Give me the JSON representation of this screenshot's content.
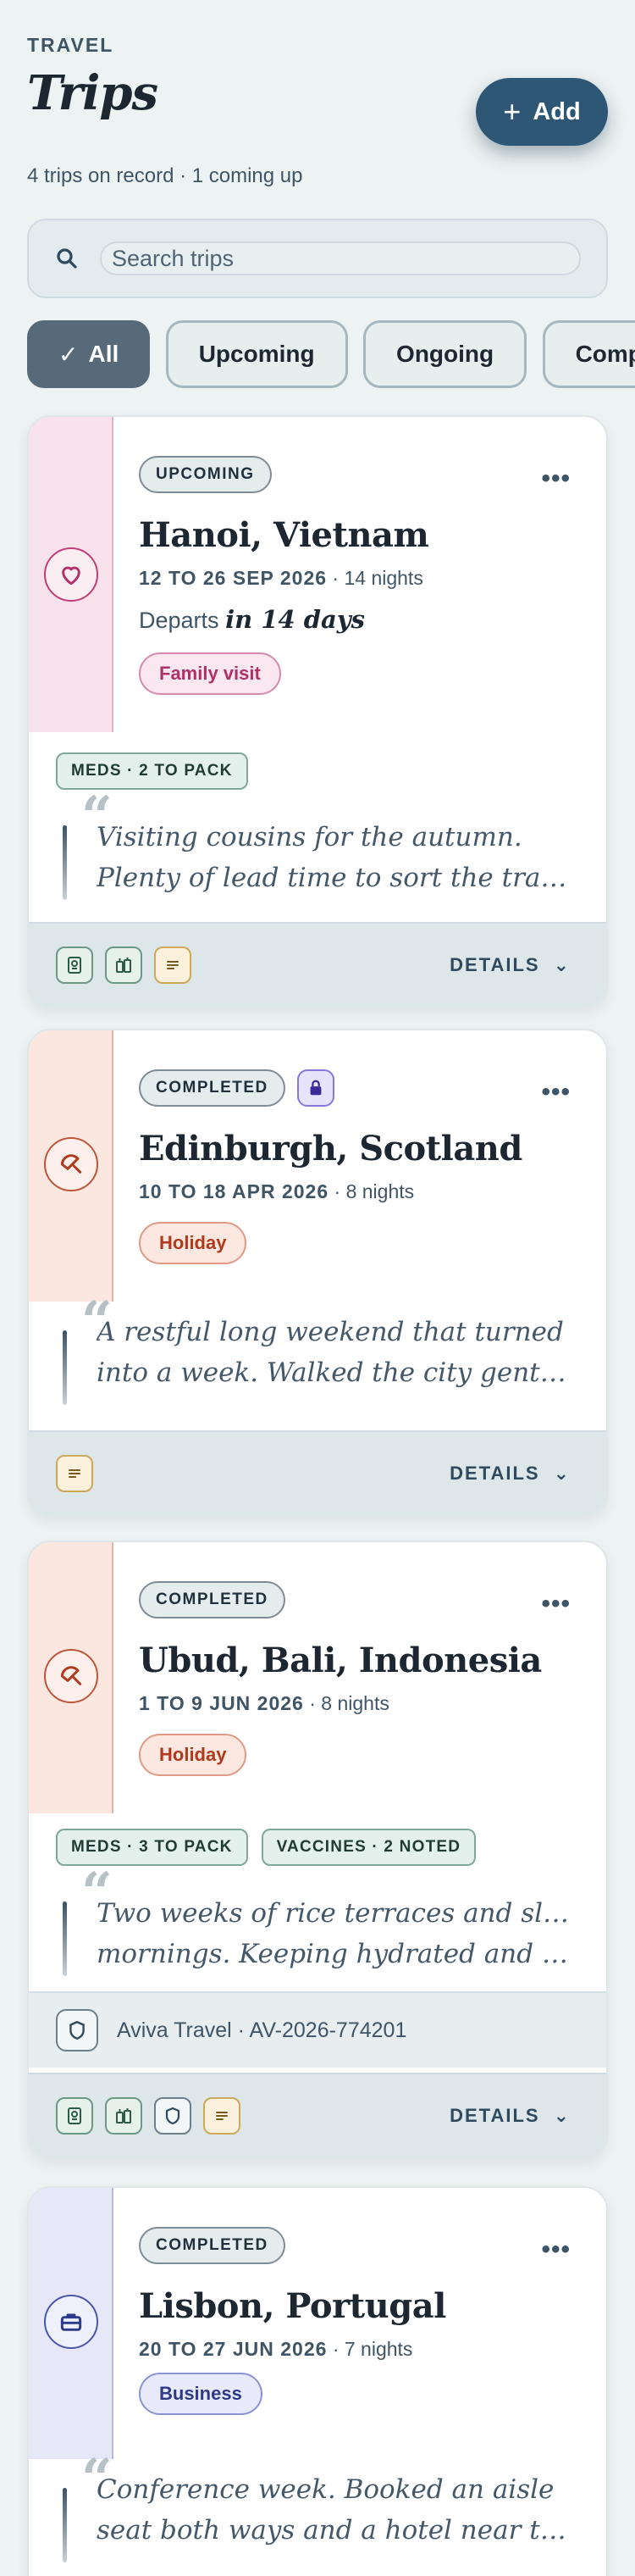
{
  "header": {
    "eyebrow": "TRAVEL",
    "title": "Trips",
    "add_label": "Add",
    "subtitle": "4 trips on record · 1 coming up"
  },
  "search": {
    "placeholder": "Search trips"
  },
  "filters": [
    {
      "label": "All",
      "active": true
    },
    {
      "label": "Upcoming",
      "active": false
    },
    {
      "label": "Ongoing",
      "active": false
    },
    {
      "label": "Completed",
      "active": false
    }
  ],
  "trips": [
    {
      "status": "UPCOMING",
      "destination": "Hanoi, Vietnam",
      "dates": "12 TO 26 SEP 2026",
      "nights": "· 14 nights",
      "departs_prefix": "Departs",
      "departs_value": "in 14 days",
      "tag": "Family visit",
      "icon": "heart-icon",
      "pills": [
        "MEDS · 2 TO PACK"
      ],
      "note_lines": [
        "Visiting cousins for the autumn.",
        "Plenty of lead time to sort the travel …"
      ],
      "footer_icons": [
        "passport-icon",
        "luggage-icon",
        "notes-icon"
      ],
      "details_label": "DETAILS"
    },
    {
      "status": "COMPLETED",
      "locked": true,
      "destination": "Edinburgh, Scotland",
      "dates": "10 TO 18 APR 2026",
      "nights": "· 8 nights",
      "tag": "Holiday",
      "icon": "beach-umbrella-icon",
      "note_lines": [
        "A restful long weekend that turned",
        "into a week. Walked the city gently a…"
      ],
      "footer_icons": [
        "notes-icon"
      ],
      "details_label": "DETAILS"
    },
    {
      "status": "COMPLETED",
      "destination": "Ubud, Bali, Indonesia",
      "dates": "1 TO 9 JUN 2026",
      "nights": "· 8 nights",
      "tag": "Holiday",
      "icon": "beach-umbrella-icon",
      "pills": [
        "MEDS · 3 TO PACK",
        "VACCINES · 2 NOTED"
      ],
      "note_lines": [
        "Two weeks of rice terraces and slow",
        "mornings. Keeping hydrated and ta…"
      ],
      "insurance": "Aviva Travel · AV-2026-774201",
      "footer_icons": [
        "passport-icon",
        "luggage-icon",
        "shield-icon",
        "notes-icon"
      ],
      "details_label": "DETAILS"
    },
    {
      "status": "COMPLETED",
      "destination": "Lisbon, Portugal",
      "dates": "20 TO 27 JUN 2026",
      "nights": "· 7 nights",
      "tag": "Business",
      "icon": "briefcase-icon",
      "note_lines": [
        "Conference week. Booked an aisle",
        "seat both ways and a hotel near the …"
      ]
    }
  ],
  "colors": {
    "accent": "#2d5775",
    "family_visit": "#b0306a",
    "holiday": "#b23a1c",
    "business": "#2d3a8c",
    "upcoming_strip": "#f7e1ea",
    "holiday_strip": "#fbe3dd",
    "business_strip": "#e4e6f8"
  }
}
